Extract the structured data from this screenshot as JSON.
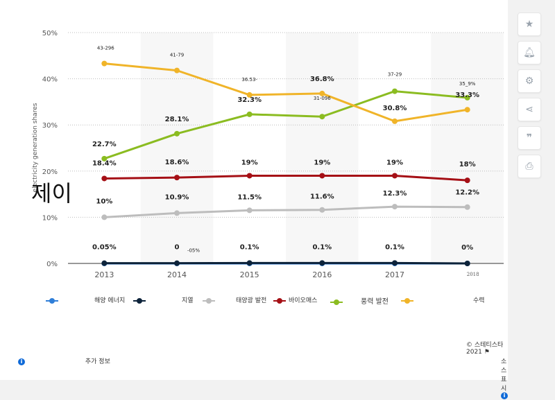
{
  "chart_data": {
    "type": "line",
    "categories": [
      "2013",
      "2014",
      "2015",
      "2016",
      "2017",
      "2018"
    ],
    "ylabel": "electricity generation shares",
    "ylim": [
      0,
      50
    ],
    "yticks": [
      "0%",
      "10%",
      "20%",
      "30%",
      "40%",
      "50%"
    ],
    "grid": true,
    "legend_position": "bottom",
    "series": [
      {
        "name": "해양 에너지",
        "color": "#2f7ed8",
        "values": [
          0,
          0,
          0,
          0,
          0,
          0
        ],
        "labels": [
          "",
          "",
          "",
          "",
          "",
          ""
        ]
      },
      {
        "name": "지열",
        "color": "#0d233a",
        "values": [
          0.05,
          0.05,
          0.1,
          0.1,
          0.1,
          0
        ],
        "labels": [
          "0.05%",
          "0",
          "0.1%",
          "0.1%",
          "0.1%",
          "0%"
        ]
      },
      {
        "name": "태양광 발전",
        "color": "#bdbdbd",
        "values": [
          10,
          10.9,
          11.5,
          11.6,
          12.3,
          12.2
        ],
        "labels": [
          "10%",
          "10.9%",
          "11.5%",
          "11.6%",
          "12.3%",
          "12.2%"
        ]
      },
      {
        "name": "바이오매스",
        "color": "#a50f15",
        "values": [
          18.4,
          18.6,
          19,
          19,
          19,
          18
        ],
        "labels": [
          "18.4%",
          "18.6%",
          "19%",
          "19%",
          "19%",
          "18%"
        ]
      },
      {
        "name": "풍력 발전",
        "color": "#8bbc21",
        "values": [
          22.7,
          28.1,
          32.3,
          31.8,
          37.3,
          35.9
        ],
        "labels": [
          "22.7%",
          "28.1%",
          "32.3%",
          "31-096",
          "37-29",
          "35_9%"
        ]
      },
      {
        "name": "수력",
        "color": "#f0b429",
        "values": [
          43.3,
          41.8,
          36.5,
          36.8,
          30.8,
          33.3
        ],
        "labels": [
          "43-296",
          "41-79",
          "36.53-",
          "36.8%",
          "30.8%",
          "33.3%"
        ]
      }
    ],
    "extra_labels": [
      "-05%"
    ]
  },
  "overlay_text": "제이",
  "footer": {
    "copyright": "스테티스타 2021",
    "more_info": "추가 정보",
    "show_source": "소스 표시"
  }
}
